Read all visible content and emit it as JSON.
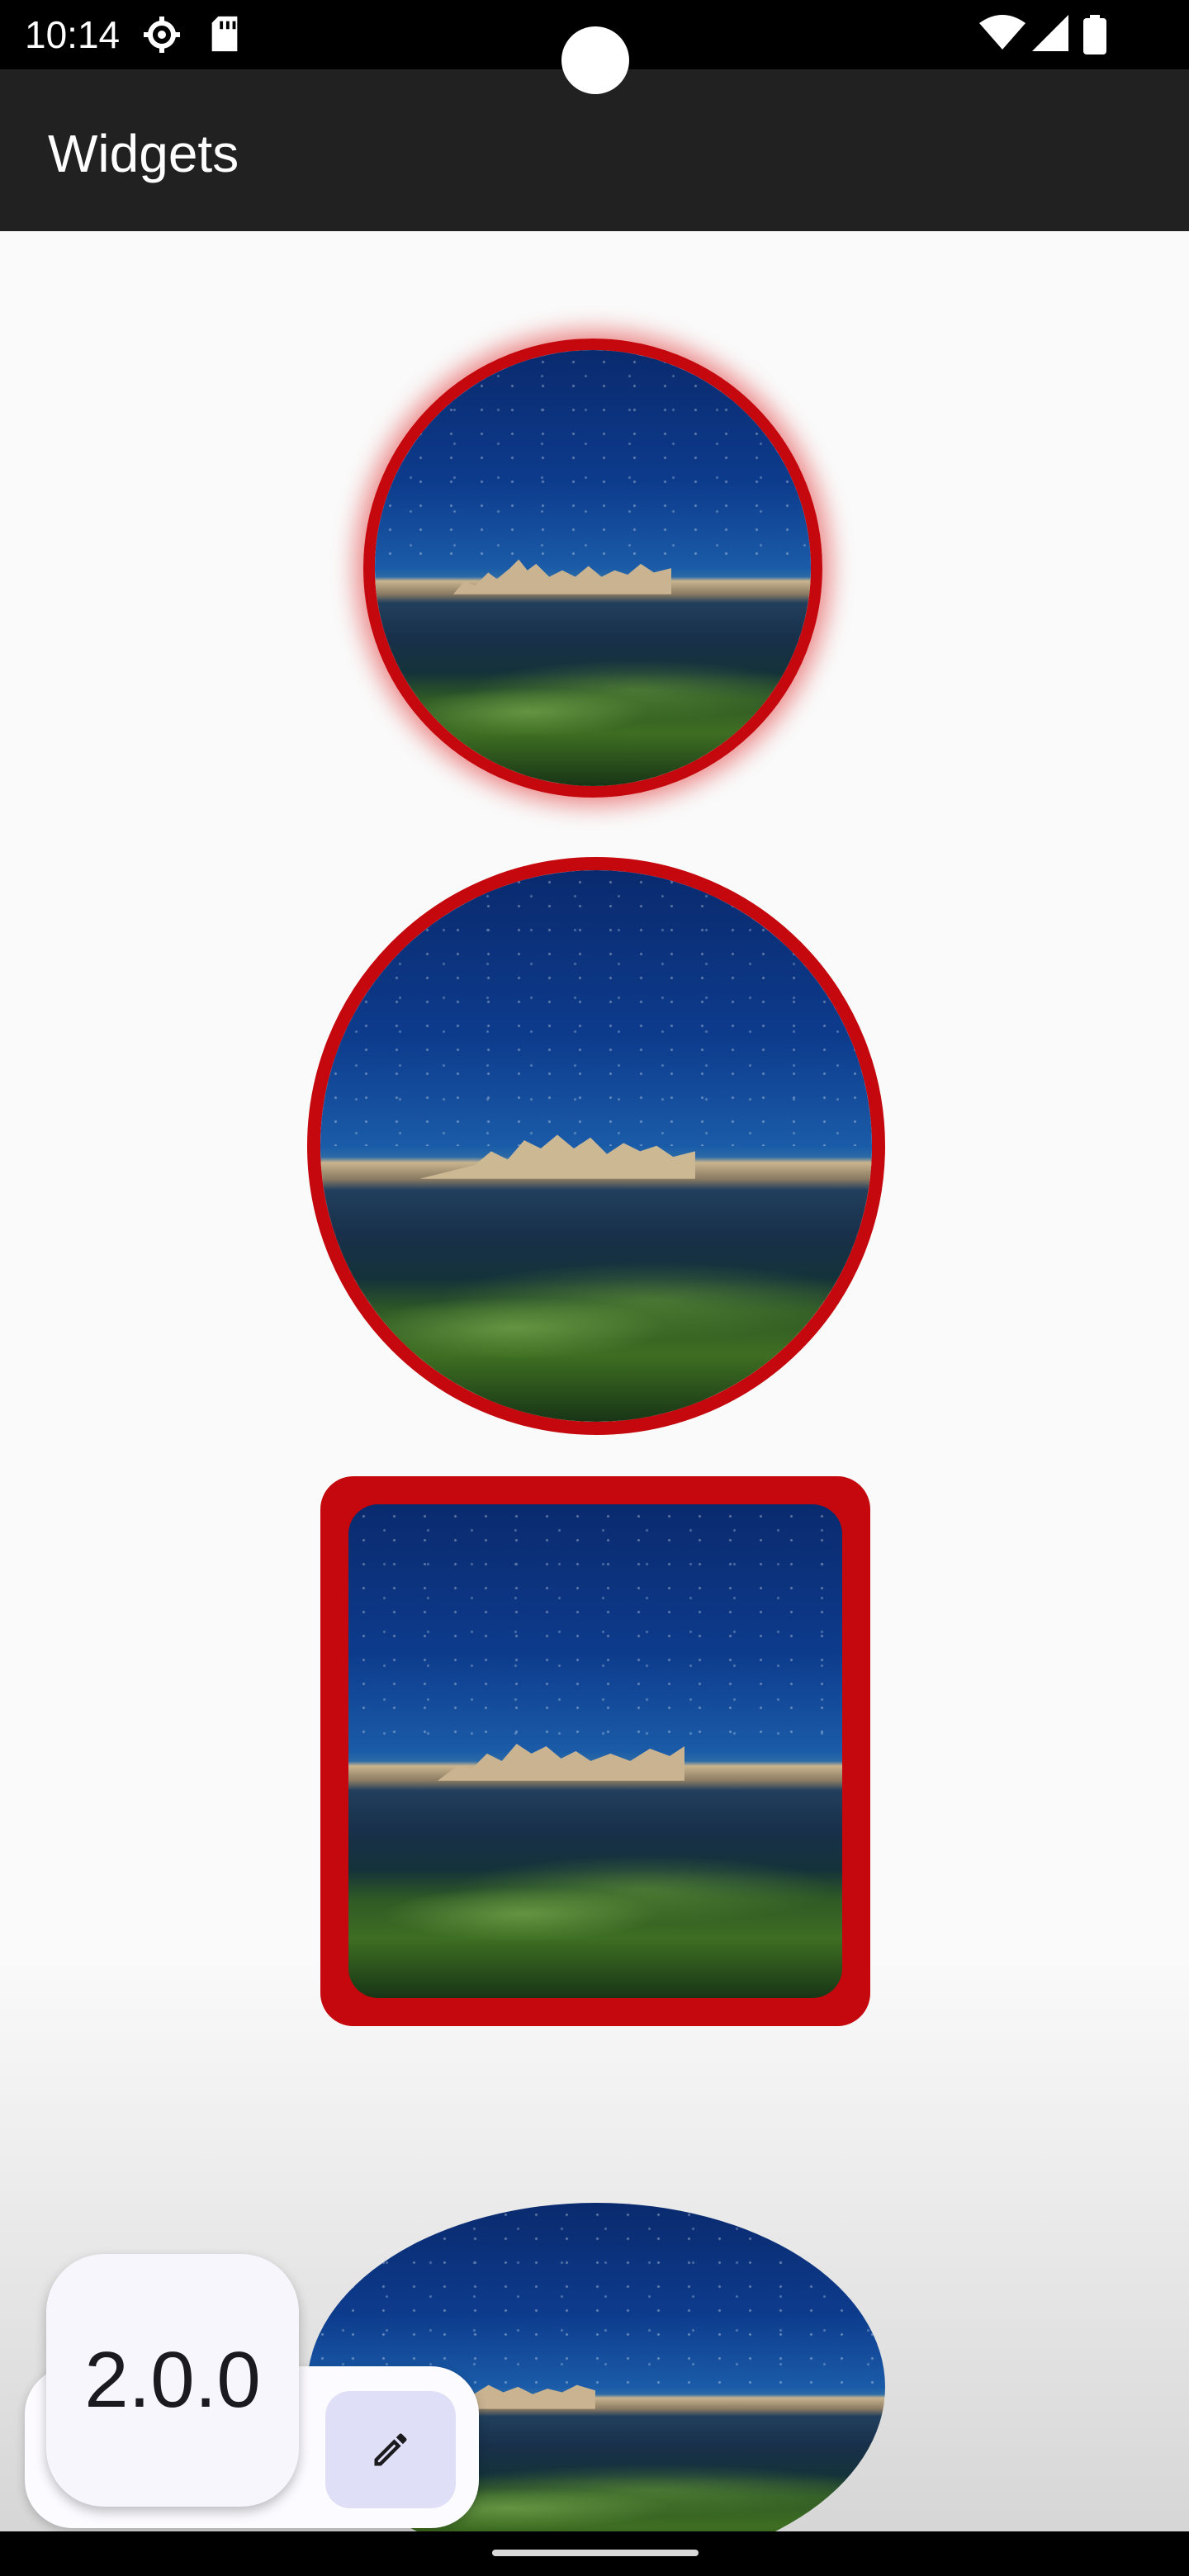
{
  "status_bar": {
    "time": "10:14",
    "left_icons": [
      "settings-icon",
      "sd-card-icon"
    ],
    "right_icons": [
      "wifi-icon",
      "signal-icon",
      "battery-icon"
    ]
  },
  "app_bar": {
    "title": "Widgets"
  },
  "image_frames": [
    {
      "shape": "circle",
      "border_color": "#c4080d",
      "glow": true
    },
    {
      "shape": "circle",
      "border_color": "#c4080d",
      "glow": false
    },
    {
      "shape": "rounded-square",
      "border_color": "#c4080d"
    },
    {
      "shape": "oval",
      "border_color": null
    }
  ],
  "version_card": {
    "label": "2.0.0"
  },
  "edit_button": {
    "icon": "pencil-icon"
  },
  "colors": {
    "accent_red": "#c4080d",
    "app_bar": "#212121",
    "button_tint": "#dfe0f8"
  }
}
